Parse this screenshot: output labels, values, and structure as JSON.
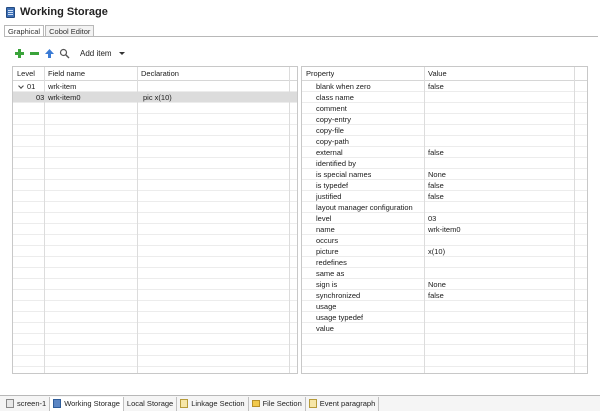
{
  "window": {
    "title": "Working Storage",
    "title_icon": "storage-icon"
  },
  "editor_tabs": [
    {
      "label": "Graphical",
      "active": true
    },
    {
      "label": "Cobol Editor",
      "active": false
    }
  ],
  "toolbar": {
    "add_item_label": "Add item"
  },
  "fields_table": {
    "columns": [
      "Level",
      "Field name",
      "Declaration"
    ],
    "rows": [
      {
        "level": "01",
        "name": "wrk-item",
        "declaration": "",
        "expanded": true,
        "selected": false
      },
      {
        "level": "03",
        "name": "wrk-item0",
        "declaration": "pic x(10)",
        "selected": true
      }
    ]
  },
  "properties_table": {
    "columns": [
      "Property",
      "Value"
    ],
    "rows": [
      {
        "property": "blank when zero",
        "value": "false"
      },
      {
        "property": "class name",
        "value": ""
      },
      {
        "property": "comment",
        "value": ""
      },
      {
        "property": "copy-entry",
        "value": ""
      },
      {
        "property": "copy-file",
        "value": ""
      },
      {
        "property": "copy-path",
        "value": ""
      },
      {
        "property": "external",
        "value": "false"
      },
      {
        "property": "identified by",
        "value": ""
      },
      {
        "property": "is special names",
        "value": "None"
      },
      {
        "property": "is typedef",
        "value": "false"
      },
      {
        "property": "justified",
        "value": "false"
      },
      {
        "property": "layout manager configuration",
        "value": ""
      },
      {
        "property": "level",
        "value": "03"
      },
      {
        "property": "name",
        "value": "wrk-item0"
      },
      {
        "property": "occurs",
        "value": ""
      },
      {
        "property": "picture",
        "value": "x(10)"
      },
      {
        "property": "redefines",
        "value": ""
      },
      {
        "property": "same as",
        "value": ""
      },
      {
        "property": "sign is",
        "value": "None"
      },
      {
        "property": "synchronized",
        "value": "false"
      },
      {
        "property": "usage",
        "value": ""
      },
      {
        "property": "usage typedef",
        "value": ""
      },
      {
        "property": "value",
        "value": ""
      }
    ]
  },
  "bottom_tabs": [
    {
      "label": "screen-1",
      "icon": "screen-icon",
      "active": false
    },
    {
      "label": "Working Storage",
      "icon": "storage-icon",
      "active": true
    },
    {
      "label": "Local Storage",
      "icon": "",
      "active": false
    },
    {
      "label": "Linkage Section",
      "icon": "linkage-icon",
      "active": false
    },
    {
      "label": "File Section",
      "icon": "folder-icon",
      "active": false
    },
    {
      "label": "Event paragraph",
      "icon": "paragraph-icon",
      "active": false
    }
  ]
}
